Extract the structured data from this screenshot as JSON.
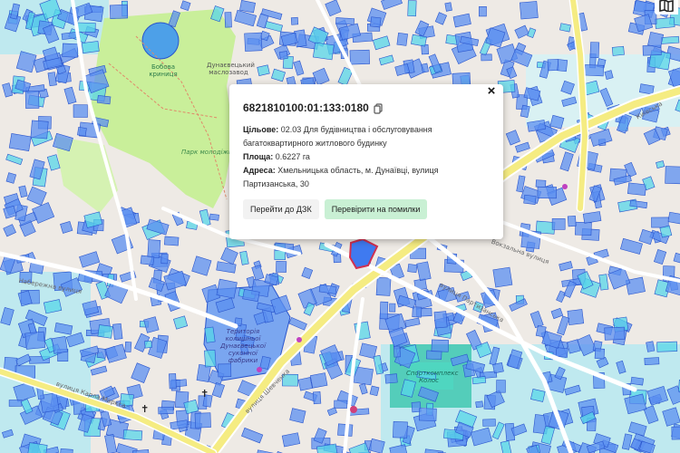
{
  "popup": {
    "cadastral_number": "6821810100:01:133:0180",
    "purpose_label": "Цільове:",
    "purpose_value": "02.03 Для будівництва і обслуговування багатоквартирного житлового будинку",
    "area_label": "Площа:",
    "area_value": "0.6227 га",
    "address_label": "Адреса:",
    "address_value": "Хмельницька область, м. Дунаївці, вулиця Партизанська, 30",
    "close": "×",
    "goto_dzk_button": "Перейти до ДЗК",
    "check_errors_button": "Перевірити на помилки"
  },
  "map_labels": {
    "park_name": "Парк молодіжний",
    "pond": "Бобова криниця",
    "top_area": "Дунаєвецький маслозавод",
    "factory_area": "Територія колишньої Дунаєвецької суконної фабрики",
    "sports": "Спорткомплекс Колос",
    "street_main": "вулиця Шевченка",
    "street_nab": "Набережна вулиця",
    "street_right_top": "Київська",
    "street_vokz": "Вокзальна вулиця",
    "street_kar": "вулиця Карла Маркса",
    "street_bottom_mid": "вулиця Партизанська"
  },
  "colors": {
    "parcel_fill": "#5b8ff0",
    "parcel_fill_light": "#57d6e8",
    "parcel_stroke": "#2a55cc",
    "selected_parcel": "#3f7af0",
    "selected_outline": "#d03050",
    "park_green": "#c9ef9a",
    "street_yellow": "#f5ec82",
    "map_bg": "#eeeae5",
    "button_green": "#c9f0d4"
  },
  "icons": [
    "copy-icon",
    "close-icon",
    "corner-book-icon",
    "church-cross-icon",
    "shop-icon"
  ]
}
